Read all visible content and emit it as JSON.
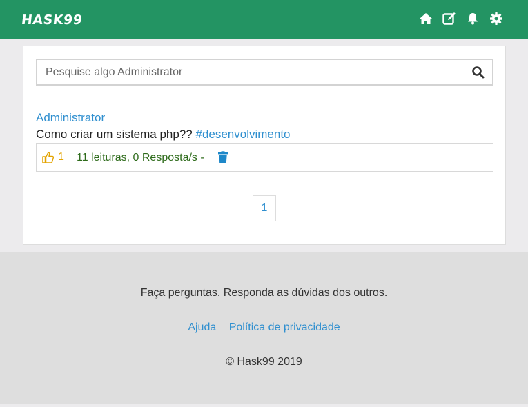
{
  "header": {
    "logo": "HASK99",
    "icons": [
      "home-icon",
      "edit-icon",
      "bell-icon",
      "gear-icon"
    ],
    "background_color": "#239463"
  },
  "search": {
    "placeholder": "Pesquise algo Administrator",
    "value": ""
  },
  "post": {
    "author": "Administrator",
    "question": "Como criar um sistema php?? ",
    "tag": "#desenvolvimento",
    "likes": "1",
    "stats": "11 leituras, 0 Resposta/s -"
  },
  "pagination": {
    "pages": [
      "1"
    ]
  },
  "footer": {
    "tagline": "Faça perguntas. Responda as dúvidas dos outros.",
    "link_help": "Ajuda",
    "link_privacy": "Política de privacidade",
    "copyright": "© Hask99 2019"
  },
  "colors": {
    "link": "#2f8fcf",
    "like": "#e3a300",
    "stats": "#2e6b1b",
    "trash": "#1e88c9"
  }
}
